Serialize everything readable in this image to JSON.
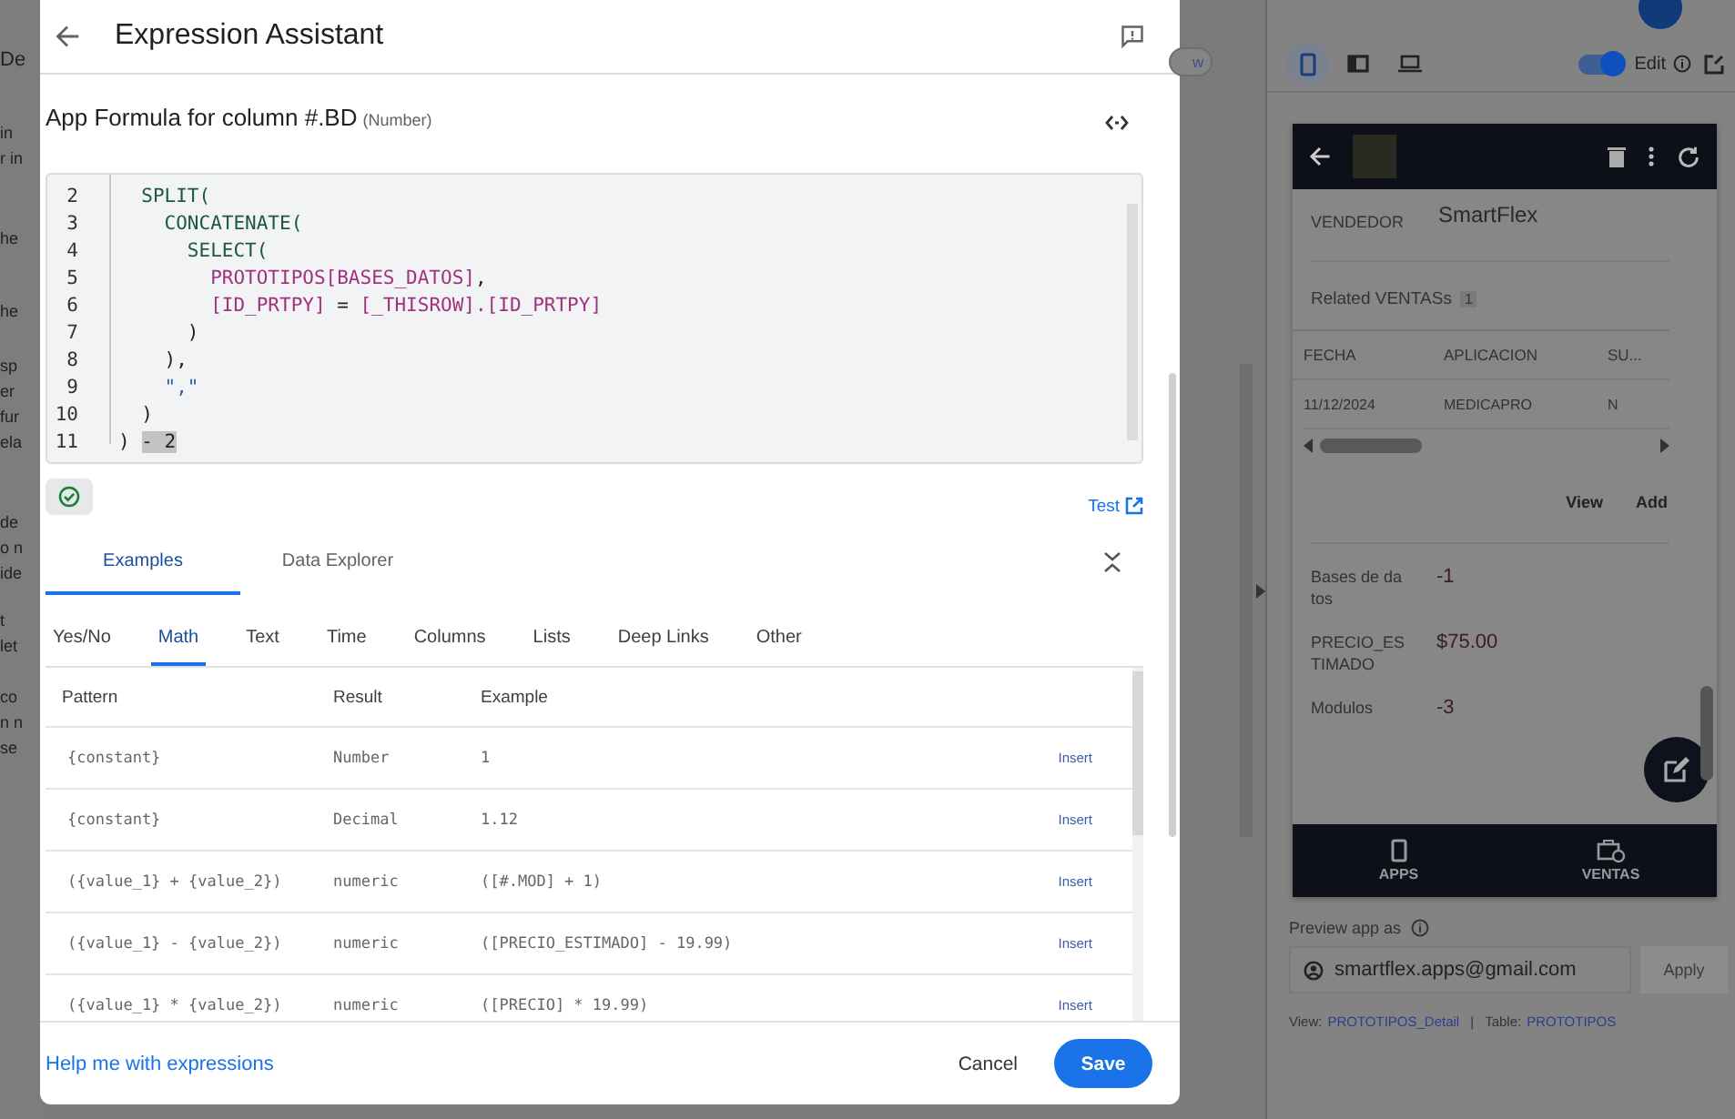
{
  "background": {
    "left_fragments": [
      [
        "De"
      ],
      [
        "in",
        "r in"
      ],
      [
        "he"
      ],
      [
        "he"
      ],
      [
        "sp",
        "er",
        "fur",
        "ela"
      ],
      [
        "de",
        "o n",
        "ide"
      ],
      [
        "t",
        "let"
      ],
      [
        "co",
        "n n",
        "se"
      ]
    ],
    "right_fragment": "w"
  },
  "dialog": {
    "title": "Expression Assistant",
    "formula_label": "App Formula for column #.BD",
    "formula_type": "(Number)",
    "code_lines": [
      {
        "number": "2",
        "segments": [
          {
            "text": "  SPLIT(",
            "kind": "fn"
          }
        ]
      },
      {
        "number": "3",
        "segments": [
          {
            "text": "    CONCATENATE(",
            "kind": "fn"
          }
        ]
      },
      {
        "number": "4",
        "segments": [
          {
            "text": "      SELECT(",
            "kind": "fn"
          }
        ]
      },
      {
        "number": "5",
        "segments": [
          {
            "text": "        PROTOTIPOS[BASES_DATOS]",
            "kind": "ref"
          },
          {
            "text": ",",
            "kind": "plain"
          }
        ]
      },
      {
        "number": "6",
        "segments": [
          {
            "text": "        [ID_PRTPY]",
            "kind": "ref"
          },
          {
            "text": " = ",
            "kind": "plain"
          },
          {
            "text": "[_THISROW].[ID_PRTPY]",
            "kind": "ref"
          }
        ]
      },
      {
        "number": "7",
        "segments": [
          {
            "text": "      )",
            "kind": "plain"
          }
        ]
      },
      {
        "number": "8",
        "segments": [
          {
            "text": "    ),",
            "kind": "plain"
          }
        ]
      },
      {
        "number": "9",
        "segments": [
          {
            "text": "    \",\"",
            "kind": "str"
          }
        ]
      },
      {
        "number": "10",
        "segments": [
          {
            "text": "  )",
            "kind": "plain"
          }
        ]
      },
      {
        "number": "11",
        "segments": [
          {
            "text": ") ",
            "kind": "plain"
          },
          {
            "text": "- 2",
            "kind": "sel"
          }
        ]
      }
    ],
    "valid": true,
    "test_link": "Test",
    "tabs": [
      {
        "label": "Examples",
        "selected": true
      },
      {
        "label": "Data Explorer",
        "selected": false
      }
    ],
    "categories": [
      {
        "label": "Yes/No",
        "selected": false
      },
      {
        "label": "Math",
        "selected": true
      },
      {
        "label": "Text",
        "selected": false
      },
      {
        "label": "Time",
        "selected": false
      },
      {
        "label": "Columns",
        "selected": false
      },
      {
        "label": "Lists",
        "selected": false
      },
      {
        "label": "Deep Links",
        "selected": false
      },
      {
        "label": "Other",
        "selected": false
      }
    ],
    "table": {
      "columns": [
        "Pattern",
        "Result",
        "Example"
      ],
      "rows": [
        {
          "pattern": "{constant}",
          "result": "Number",
          "example": "1",
          "action": "Insert"
        },
        {
          "pattern": "{constant}",
          "result": "Decimal",
          "example": "1.12",
          "action": "Insert"
        },
        {
          "pattern": "({value_1} + {value_2})",
          "result": "numeric",
          "example": "([#.MOD] + 1)",
          "action": "Insert"
        },
        {
          "pattern": "({value_1} - {value_2})",
          "result": "numeric",
          "example": "([PRECIO_ESTIMADO] - 19.99)",
          "action": "Insert"
        },
        {
          "pattern": "({value_1} * {value_2})",
          "result": "numeric",
          "example": "([PRECIO] * 19.99)",
          "action": "Insert"
        }
      ]
    },
    "help_link": "Help me with expressions",
    "buttons": {
      "cancel": "Cancel",
      "save": "Save"
    }
  },
  "preview": {
    "devices": [
      {
        "kind": "phone",
        "selected": true
      },
      {
        "kind": "tablet",
        "selected": false
      },
      {
        "kind": "desktop",
        "selected": false
      }
    ],
    "edit_toggle": {
      "label": "Edit",
      "on": true
    },
    "app": {
      "fields_top": [
        {
          "label": "VENDEDOR",
          "value": "SmartFlex"
        }
      ],
      "related": {
        "title": "Related VENTASs",
        "count": "1",
        "columns": [
          "FECHA",
          "APLICACION",
          "SU..."
        ],
        "rows": [
          [
            "11/12/2024",
            "MEDICAPRO",
            "N"
          ]
        ],
        "actions": [
          "View",
          "Add"
        ]
      },
      "fields": [
        {
          "label": "Bases de datos",
          "value": "-1"
        },
        {
          "label": "PRECIO_ESTIMADO",
          "value": "$75.00"
        },
        {
          "label": "Modulos",
          "value": "-3"
        }
      ],
      "nav": [
        {
          "label": "APPS",
          "kind": "phone"
        },
        {
          "label": "VENTAS",
          "kind": "briefcase"
        }
      ]
    },
    "preview_as": {
      "label": "Preview app as",
      "email": "smartflex.apps@gmail.com",
      "apply": "Apply"
    },
    "footer": {
      "view_label": "View:",
      "view": "PROTOTIPOS_Detail",
      "separator": "|",
      "table_label": "Table:",
      "table": "PROTOTIPOS"
    }
  }
}
